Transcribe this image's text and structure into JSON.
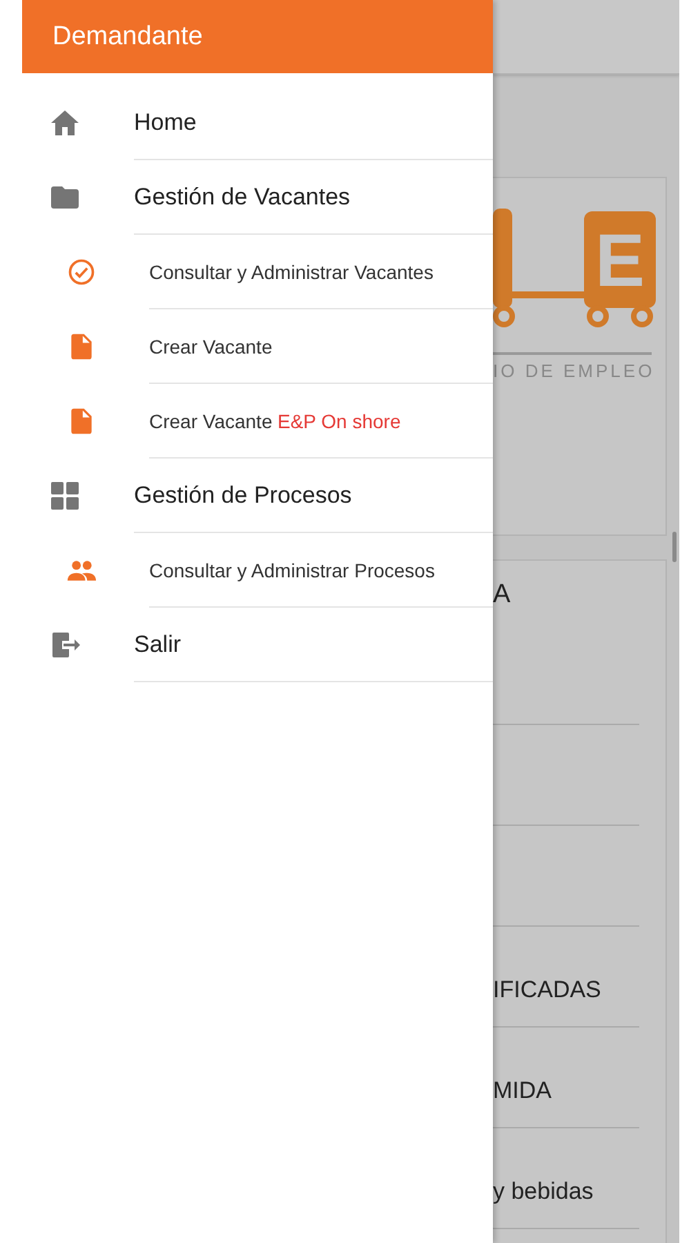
{
  "drawer": {
    "title": "Demandante",
    "items": [
      {
        "kind": "main",
        "label": "Home"
      },
      {
        "kind": "main",
        "label": "Gestión de Vacantes"
      },
      {
        "kind": "sub",
        "label": "Consultar y Administrar Vacantes"
      },
      {
        "kind": "sub",
        "label": "Crear Vacante"
      },
      {
        "kind": "sub",
        "label": "Crear Vacante",
        "highlight": "E&P On shore"
      },
      {
        "kind": "main",
        "label": "Gestión de Procesos"
      },
      {
        "kind": "sub",
        "label": "Consultar y Administrar Procesos"
      },
      {
        "kind": "main",
        "label": "Salir"
      }
    ]
  },
  "background": {
    "logo": {
      "letter": "E",
      "tagline": "IO DE EMPLEO"
    },
    "heading": "A",
    "rows": [
      "IFICADAS",
      "MIDA",
      "y bebidas"
    ]
  }
}
